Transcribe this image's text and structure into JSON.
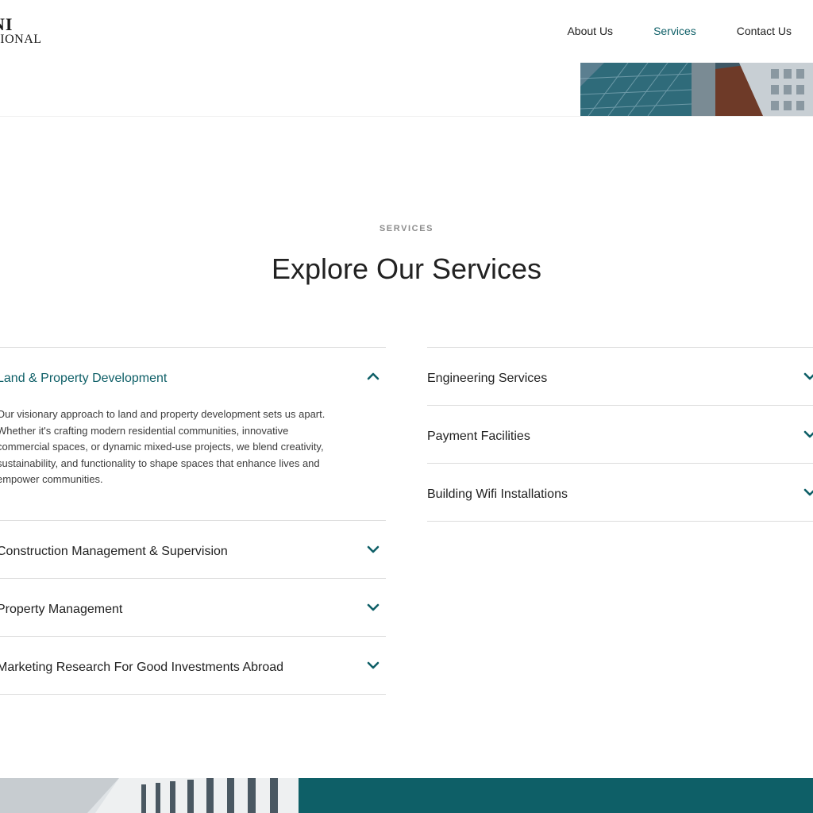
{
  "brand": {
    "logo_line1": "NI",
    "logo_line2": "TIONAL"
  },
  "nav": {
    "items": [
      "About Us",
      "Services",
      "Contact Us"
    ],
    "active": "Services"
  },
  "services_section": {
    "eyebrow": "SERVICES",
    "title": "Explore Our Services",
    "left_items": [
      {
        "title": "Land & Property Development",
        "expanded": true,
        "body": "Our visionary approach to land and property development sets us apart. Whether it's crafting modern residential communities, innovative commercial spaces, or dynamic mixed-use projects, we blend creativity, sustainability, and functionality to shape spaces that enhance lives and empower communities."
      },
      {
        "title": "Construction Management & Supervision",
        "expanded": false
      },
      {
        "title": "Property Management",
        "expanded": false
      },
      {
        "title": "Marketing Research For Good Investments Abroad",
        "expanded": false
      }
    ],
    "right_items": [
      {
        "title": "Engineering Services",
        "expanded": false
      },
      {
        "title": "Payment Facilities",
        "expanded": false
      },
      {
        "title": "Building Wifi Installations",
        "expanded": false
      }
    ]
  },
  "icons": {
    "expanded": "chevron-up-icon",
    "collapsed": "chevron-down-icon"
  },
  "colors": {
    "accent": "#0e5f67",
    "divider": "#dcdcdc",
    "text": "#222222",
    "muted": "#8c8c8c"
  }
}
